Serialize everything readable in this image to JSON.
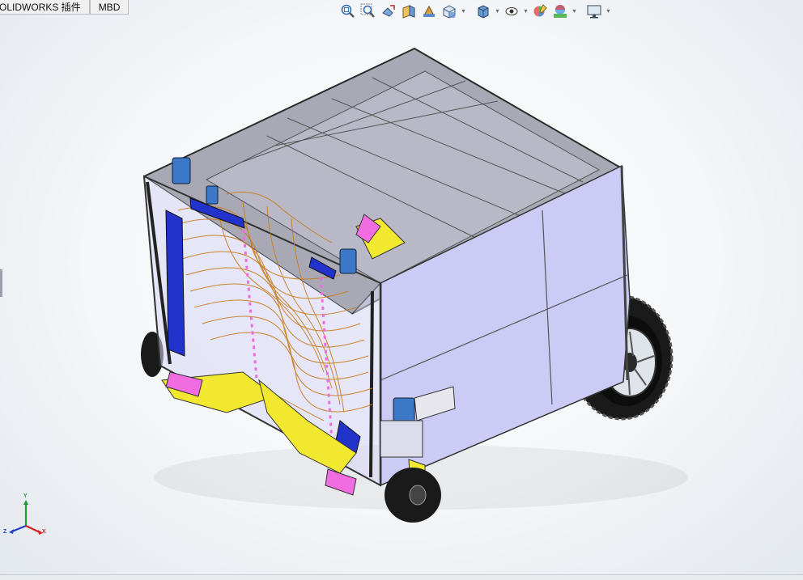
{
  "command_tabs": [
    "OLIDWORKS 插件",
    "MBD"
  ],
  "hud_icons": [
    {
      "name": "zoom-to-fit-icon",
      "dropdown": false
    },
    {
      "name": "zoom-to-area-icon",
      "dropdown": false
    },
    {
      "name": "previous-view-icon",
      "dropdown": false
    },
    {
      "name": "section-view-icon",
      "dropdown": false
    },
    {
      "name": "dynamic-annotation-views-icon",
      "dropdown": false
    },
    {
      "name": "view-orientation-icon",
      "dropdown": true
    },
    {
      "name": "display-style-icon",
      "dropdown": true
    },
    {
      "name": "hide-show-items-icon",
      "dropdown": true
    },
    {
      "name": "edit-appearance-icon",
      "dropdown": false
    },
    {
      "name": "apply-scene-icon",
      "dropdown": true
    },
    {
      "name": "view-settings-icon",
      "dropdown": true
    }
  ],
  "triad": {
    "x_label": "X",
    "y_label": "Y",
    "z_label": "Z",
    "x_color": "#d92020",
    "y_color": "#1f9a2f",
    "z_color": "#2040c8"
  },
  "colors": {
    "frame": "#c9c9f2",
    "frame_edge": "#404050",
    "blue": "#2233cc",
    "yellow": "#f2e830",
    "pink": "#f06ce0",
    "tine": "#c97a1a"
  }
}
